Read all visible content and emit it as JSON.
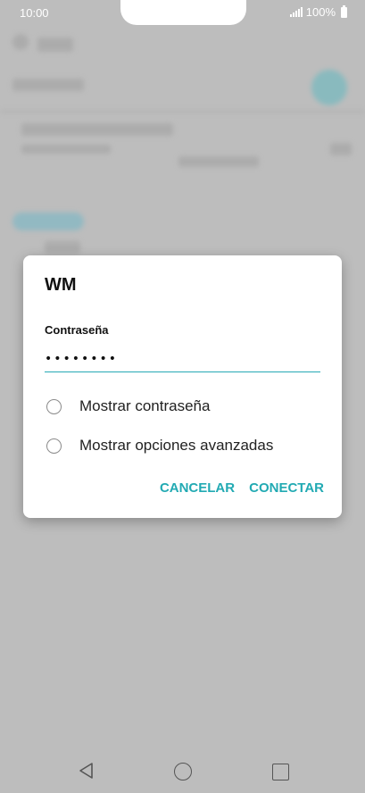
{
  "status_bar": {
    "time": "10:00",
    "battery": "100%",
    "signal_icon": "signal-icon",
    "battery_icon": "battery-icon"
  },
  "dialog": {
    "title": "WM",
    "password_label": "Contraseña",
    "password_value": "••••••••",
    "options": [
      {
        "label": "Mostrar contraseña",
        "checked": false
      },
      {
        "label": "Mostrar opciones avanzadas",
        "checked": false
      }
    ],
    "cancel_label": "CANCELAR",
    "connect_label": "CONECTAR"
  },
  "navigation": {
    "back_icon": "back-icon",
    "home_icon": "home-icon",
    "recent_icon": "recent-apps-icon"
  },
  "colors": {
    "accent": "#22aab3",
    "scrim": "#bdbdbd"
  }
}
